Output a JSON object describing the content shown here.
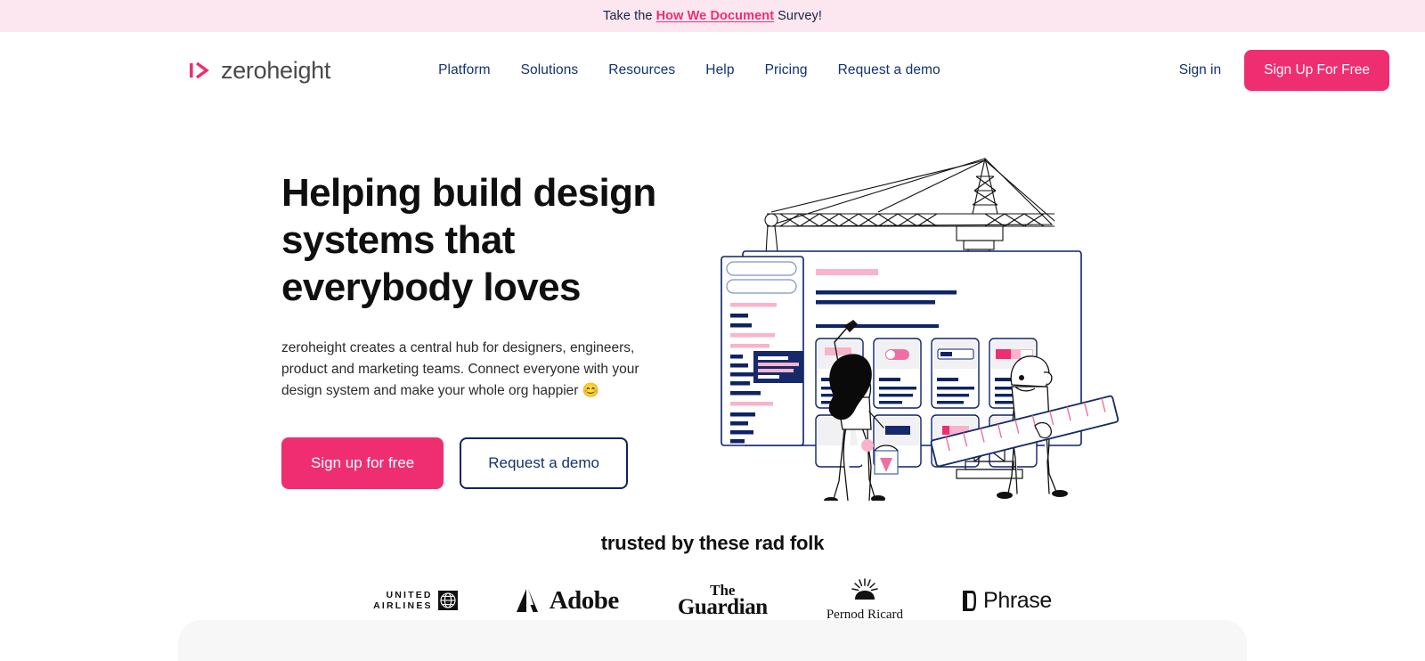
{
  "banner": {
    "prefix": "Take the",
    "link": "How We Document",
    "suffix": "Survey!"
  },
  "header": {
    "logo_text": "zeroheight",
    "logo_icon": "zeroheight-chevron-icon",
    "nav": [
      {
        "label": "Platform"
      },
      {
        "label": "Solutions"
      },
      {
        "label": "Resources"
      },
      {
        "label": "Help"
      },
      {
        "label": "Pricing"
      },
      {
        "label": "Request a demo"
      }
    ],
    "signin_label": "Sign in",
    "signup_label": "Sign Up For Free"
  },
  "hero": {
    "title": "Helping build design systems that everybody loves",
    "subtitle": "zeroheight creates a central hub for designers, engineers, product and marketing teams. Connect everyone with your design system and make your whole org happier 😊",
    "primary_cta": "Sign up for free",
    "secondary_cta": "Request a demo",
    "illustration_name": "crane-building-design-system-illustration"
  },
  "trusted": {
    "title": "trusted by these rad folk",
    "logos": [
      {
        "name": "united-airlines-logo",
        "line1": "UNITED",
        "line2": "AIRLINES"
      },
      {
        "name": "adobe-logo",
        "word": "Adobe"
      },
      {
        "name": "the-guardian-logo",
        "word1": "The",
        "word2": "Guardian"
      },
      {
        "name": "pernod-ricard-logo",
        "word": "Pernod Ricard"
      },
      {
        "name": "phrase-logo",
        "word": "Phrase"
      }
    ]
  },
  "colors": {
    "pink": "#ef2e72",
    "pink_light": "#fce6ef",
    "navy": "#0d2366",
    "nav_blue": "#123274",
    "pink_pale": "#f9b3cb"
  }
}
